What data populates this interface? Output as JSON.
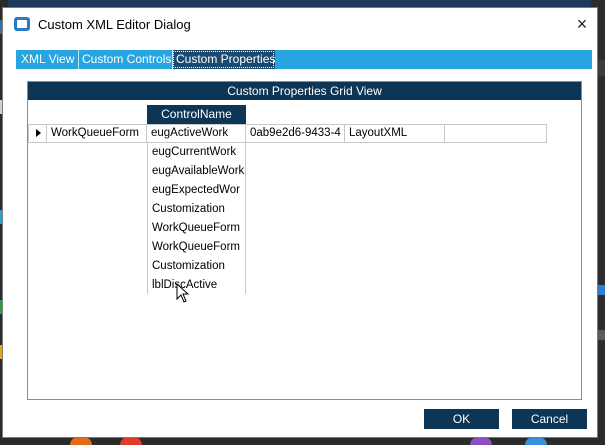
{
  "dialog": {
    "title": "Custom XML Editor Dialog",
    "close_label": "×"
  },
  "tabs": [
    {
      "label": "XML View",
      "active": false
    },
    {
      "label": "Custom Controls",
      "active": false
    },
    {
      "label": "Custom Properties",
      "active": true
    }
  ],
  "grid": {
    "title": "Custom Properties Grid View",
    "column_header": "ControlName",
    "row": {
      "first": "WorkQueueForm",
      "control_name": "eugActiveWork",
      "guid": "0ab9e2d6-9433-4",
      "type": "LayoutXML",
      "extra": ""
    },
    "dropdown_items": [
      "eugCurrentWork",
      "eugAvailableWork",
      "eugExpectedWor",
      "Customization",
      "WorkQueueForm",
      "WorkQueueForm",
      "Customization",
      "lblDiscActive"
    ]
  },
  "buttons": {
    "ok": "OK",
    "cancel": "Cancel"
  },
  "colors": {
    "tab_strip": "#27a5e0",
    "header_navy": "#0c3556",
    "button_navy": "#0c3556"
  }
}
